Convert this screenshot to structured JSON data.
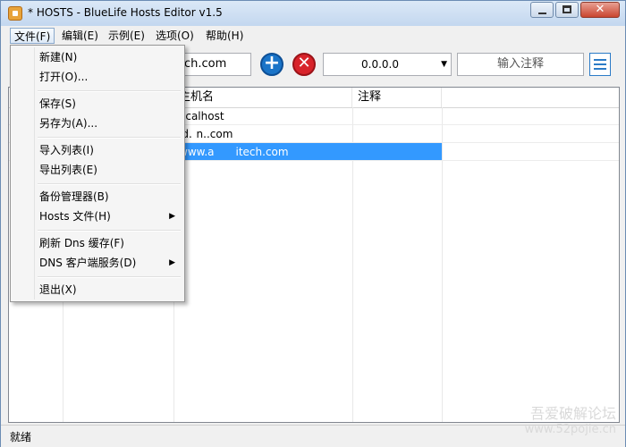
{
  "window": {
    "title": "* HOSTS - BlueLife Hosts Editor v1.5"
  },
  "menubar": {
    "file": "文件(F)",
    "edit": "编辑(E)",
    "examples": "示例(E)",
    "options": "选项(O)",
    "help": "帮助(H)"
  },
  "file_menu": {
    "new": "新建(N)",
    "open": "打开(O)...",
    "save": "保存(S)",
    "save_as": "另存为(A)...",
    "import_list": "导入列表(I)",
    "export_list": "导出列表(E)",
    "backup_manager": "备份管理器(B)",
    "hosts_file": "Hosts 文件(H)",
    "flush_dns": "刷新 Dns 缓存(F)",
    "dns_client": "DNS 客户端服务(D)",
    "exit": "退出(X)"
  },
  "toolbar": {
    "host_input_value": "ch.com",
    "ip_value": "0.0.0.0",
    "comment_placeholder": "输入注释"
  },
  "grid": {
    "columns": {
      "hostname": "主机名",
      "comment": "注释"
    },
    "rows": [
      {
        "host": "ocalhost",
        "selected": false
      },
      {
        "host": "id.  n..com",
        "selected": false
      },
      {
        "host": "www.a  itech.com",
        "selected": true
      }
    ]
  },
  "statusbar": {
    "text": "就绪"
  },
  "watermark": {
    "line1": "吾爱破解论坛",
    "line2": "www.52pojie.cn"
  },
  "colors": {
    "selection": "#3399ff",
    "add": "#1a74c8",
    "delete": "#d8232a"
  }
}
